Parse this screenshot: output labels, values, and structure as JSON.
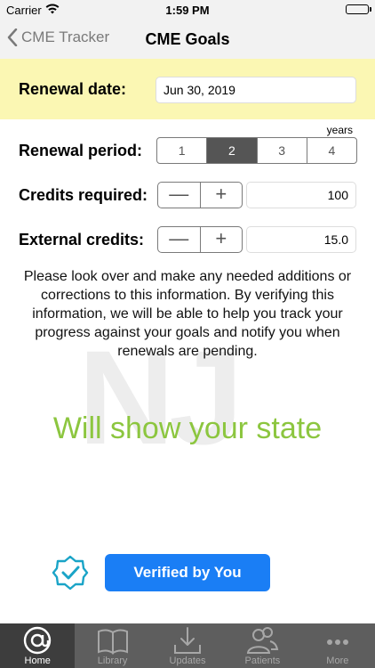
{
  "status_bar": {
    "carrier": "Carrier",
    "time": "1:59 PM",
    "battery_level": 1.0
  },
  "nav": {
    "back_label": "CME Tracker",
    "title": "CME Goals"
  },
  "renewal_date": {
    "label": "Renewal date:",
    "value": "Jun 30, 2019"
  },
  "renewal_period": {
    "label": "Renewal period:",
    "unit": "years",
    "options": [
      "1",
      "2",
      "3",
      "4"
    ],
    "selected": "2"
  },
  "credits_required": {
    "label": "Credits required:",
    "minus": "—",
    "plus": "+",
    "value": "100"
  },
  "external_credits": {
    "label": "External credits:",
    "minus": "—",
    "plus": "+",
    "value": "15.0"
  },
  "info_text": "Please look over and make any needed additions or corrections to this information. By verifying this information, we will be able to help you track your progress against your goals and notify you when renewals are pending.",
  "watermark": "NJ",
  "state_text": "Will show your state",
  "verify_button": "Verified by You",
  "colors": {
    "accent_blue": "#1a7ef5",
    "green": "#8cc63f",
    "band_yellow": "#fbf7b3"
  },
  "tabs": [
    {
      "label": "Home",
      "icon": "at-icon",
      "active": true
    },
    {
      "label": "Library",
      "icon": "book-icon",
      "active": false
    },
    {
      "label": "Updates",
      "icon": "download-icon",
      "active": false
    },
    {
      "label": "Patients",
      "icon": "people-icon",
      "active": false
    },
    {
      "label": "More",
      "icon": "more-dots-icon",
      "active": false
    }
  ]
}
